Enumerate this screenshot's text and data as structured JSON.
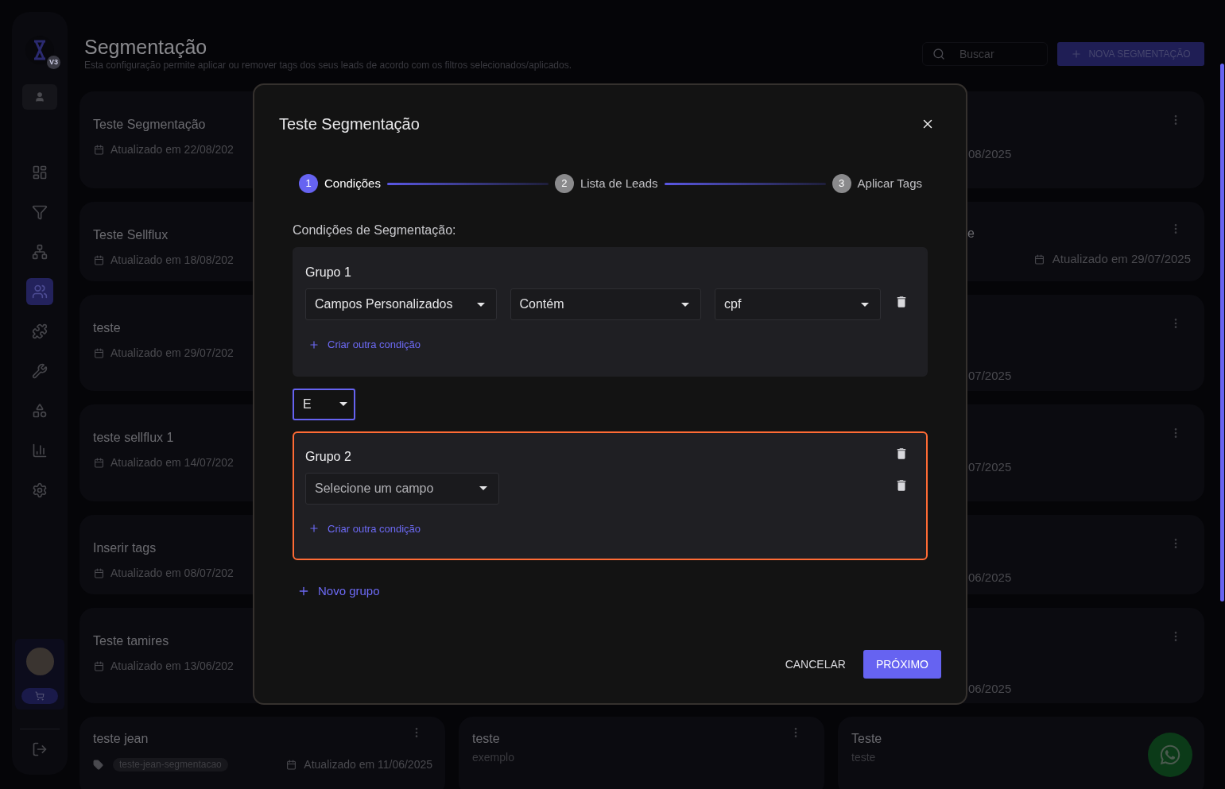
{
  "sidebar": {
    "badge": "V3",
    "nav_items": [
      {
        "selected": false
      },
      {
        "selected": false
      },
      {
        "selected": false
      },
      {
        "selected": true
      },
      {
        "selected": false
      },
      {
        "selected": false
      },
      {
        "selected": false
      },
      {
        "selected": false
      },
      {
        "selected": false
      }
    ]
  },
  "header": {
    "title": "Segmentação",
    "subtitle": "Esta configuração permite aplicar ou remover tags dos seus leads de acordo com os filtros selecionados/aplicados.",
    "search": {
      "placeholder": "Buscar"
    },
    "new_button": "NOVA SEGMENTAÇÃO"
  },
  "cards_left": [
    {
      "title": "Teste Segmentação",
      "date": "Atualizado em 22/08/202"
    },
    {
      "title": "Teste Sellflux",
      "date": "Atualizado em 18/08/202"
    },
    {
      "title": "teste",
      "date": "Atualizado em 29/07/202"
    },
    {
      "title": "teste sellflux 1",
      "date": "Atualizado em 14/07/202"
    },
    {
      "title": "Inserir tags",
      "date": "Atualizado em 08/07/202"
    },
    {
      "title": "Teste tamires",
      "date": "Atualizado em 13/06/202"
    }
  ],
  "cards_right": [
    {
      "kind": "fragment",
      "date": "08/2025"
    },
    {
      "kind": "right_date",
      "title": "e",
      "date": "Atualizado em 29/07/2025"
    },
    {
      "kind": "fragment_low",
      "date": "07/2025"
    },
    {
      "kind": "fragment",
      "date": "07/2025"
    },
    {
      "kind": "fragment",
      "date": "06/2025"
    },
    {
      "kind": "fragment_low",
      "date": "06/2025"
    }
  ],
  "cards_bottom": [
    {
      "kind": "tagged",
      "title": "teste jean",
      "tag": "teste-jean-segmentacao",
      "date": "Atualizado em 11/06/2025"
    },
    {
      "kind": "described",
      "title": "teste",
      "description": "exemplo"
    },
    {
      "kind": "described",
      "title": "Teste",
      "description": "teste"
    }
  ],
  "modal": {
    "title": "Teste Segmentação",
    "steps": [
      {
        "number": "1",
        "label": "Condições",
        "selected": true
      },
      {
        "number": "2",
        "label": "Lista de Leads",
        "selected": false
      },
      {
        "number": "3",
        "label": "Aplicar Tags",
        "selected": false
      }
    ],
    "section_label": "Condições de Segmentação:",
    "groups": [
      {
        "title": "Grupo 1",
        "highlighted": false,
        "deletable": false,
        "conditions": [
          {
            "fields": [
              {
                "value": "Campos Personalizados"
              },
              {
                "value": "Contém"
              },
              {
                "value": "cpf"
              }
            ]
          }
        ],
        "add_label": "Criar outra condição"
      },
      {
        "title": "Grupo 2",
        "highlighted": true,
        "deletable": true,
        "conditions": [
          {
            "fields": [
              {
                "placeholder": "Selecione um campo"
              }
            ]
          }
        ],
        "add_label": "Criar outra condição"
      }
    ],
    "connector": {
      "value": "E"
    },
    "add_group": "Novo grupo",
    "cancel": "CANCELAR",
    "next": "PRÓXIMO"
  }
}
